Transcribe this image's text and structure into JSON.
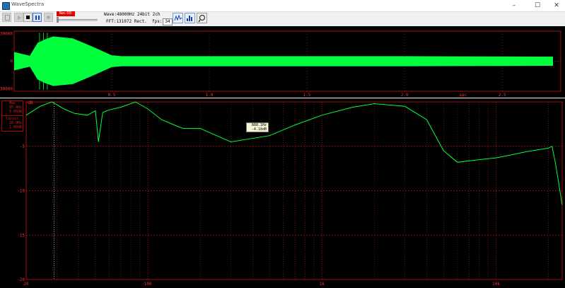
{
  "app": {
    "title": "WaveSpectra",
    "minimize_label": "–",
    "maximize_label": "☐",
    "close_label": "✕"
  },
  "toolbar": {
    "rec_label": "Rec 00:",
    "wave_info": "Wave:48000Hz 24bit 2ch",
    "fft_info": "FFT:131072 Rect.",
    "fps_label": "fps:",
    "fps_value": "34"
  },
  "icons": [
    "app-icon",
    "copy-icon",
    "play-icon",
    "stop-icon",
    "pause-icon",
    "record-icon",
    "waveform-icon",
    "spectrum-icon",
    "settings-icon"
  ],
  "colors": {
    "signal": "#00ff3c",
    "grid": "#ff2020",
    "axis_text": "#ff3030",
    "background": "#000000"
  },
  "wave_panel": {
    "y_ticks": [
      "30000",
      "0",
      "-30000"
    ],
    "x_ticks": [
      "0.5",
      "1.0",
      "1.5",
      "2.0",
      "2.5"
    ],
    "x_unit": "sec",
    "x_range_sec": [
      0,
      2.8
    ],
    "y_range": [
      -32768,
      32767
    ]
  },
  "spectrum_panel": {
    "y_unit": "dB",
    "y_ticks": [
      "-5",
      "-10",
      "-15",
      "-20"
    ],
    "x_ticks": [
      "20",
      "100",
      "1k",
      "10k"
    ],
    "x_scale": "log",
    "x_range_hz": [
      20,
      24000
    ],
    "y_range_db": [
      -20,
      0
    ],
    "info_box": {
      "max_label": "Max",
      "max_freq": "85.4Hz",
      "max_level": "0.00dB",
      "cursor_label": "Cursor",
      "cursor_freq": "28.9Hz",
      "cursor_level": "1.00dB"
    },
    "tooltip": {
      "freq": "888.1Hz",
      "level": "-4.18dB"
    }
  },
  "chart_data": [
    {
      "type": "area",
      "x_label": "sec",
      "x_range": [
        0,
        2.8
      ],
      "y_range": [
        -32768,
        32767
      ],
      "series": [
        {
          "name": "",
          "x": [
            0.0,
            0.08,
            0.12,
            0.16,
            0.2,
            0.3,
            0.4,
            0.5,
            0.55,
            0.6,
            0.8,
            1.0,
            1.5,
            2.0,
            2.5,
            2.76
          ],
          "y": [
            10000,
            6000,
            20000,
            24000,
            27000,
            25000,
            16000,
            6500,
            5500,
            5500,
            5500,
            5500,
            5500,
            5500,
            5200,
            5000
          ]
        }
      ]
    },
    {
      "type": "line",
      "x_label": "",
      "y_label": "dB",
      "x_scale": "log",
      "x_range": [
        20,
        24000
      ],
      "y_range": [
        -20,
        0
      ],
      "series": [
        {
          "name": "",
          "x": [
            20,
            24,
            28,
            30,
            33,
            38,
            45,
            50,
            52,
            55,
            58,
            60,
            70,
            85,
            100,
            120,
            150,
            160,
            200,
            300,
            500,
            700,
            1000,
            1500,
            2000,
            3000,
            4000,
            5000,
            6000,
            8000,
            10000,
            12000,
            15000,
            20000,
            21000,
            22000,
            24000
          ],
          "y": [
            -1.5,
            -0.5,
            0.0,
            -0.3,
            -0.8,
            -1.3,
            -1.5,
            -1.0,
            -4.5,
            -1.2,
            -1.0,
            -0.9,
            -0.6,
            0.0,
            -0.8,
            -2.0,
            -2.8,
            -3.0,
            -3.0,
            -4.5,
            -3.8,
            -2.6,
            -1.5,
            -0.6,
            -0.2,
            -0.5,
            -2.0,
            -5.5,
            -6.8,
            -6.5,
            -6.3,
            -6.0,
            -5.6,
            -5.2,
            -5.0,
            -7.0,
            -11.6
          ]
        }
      ]
    }
  ]
}
